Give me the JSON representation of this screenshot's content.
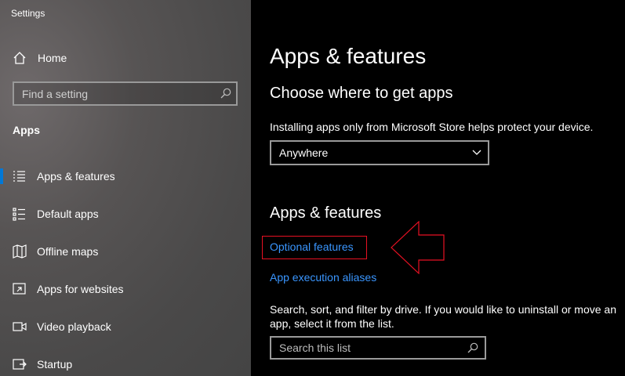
{
  "window": {
    "title": "Settings"
  },
  "sidebar": {
    "home_label": "Home",
    "search_placeholder": "Find a setting",
    "section_label": "Apps",
    "items": [
      {
        "label": "Apps & features",
        "icon": "apps-features-icon",
        "selected": true
      },
      {
        "label": "Default apps",
        "icon": "default-apps-icon"
      },
      {
        "label": "Offline maps",
        "icon": "map-icon"
      },
      {
        "label": "Apps for websites",
        "icon": "open-in-app-icon"
      },
      {
        "label": "Video playback",
        "icon": "video-icon"
      },
      {
        "label": "Startup",
        "icon": "startup-icon"
      }
    ]
  },
  "main": {
    "title": "Apps & features",
    "choose_heading": "Choose where to get apps",
    "choose_desc": "Installing apps only from Microsoft Store helps protect your device.",
    "source_dropdown": {
      "value": "Anywhere"
    },
    "features_heading": "Apps & features",
    "optional_features_link": "Optional features",
    "aliases_link": "App execution aliases",
    "list_desc": "Search, sort, and filter by drive. If you would like to uninstall or move an app, select it from the list.",
    "list_search_placeholder": "Search this list"
  },
  "colors": {
    "accent": "#0078d7",
    "link": "#3a96ff",
    "annotation": "#e81123"
  }
}
